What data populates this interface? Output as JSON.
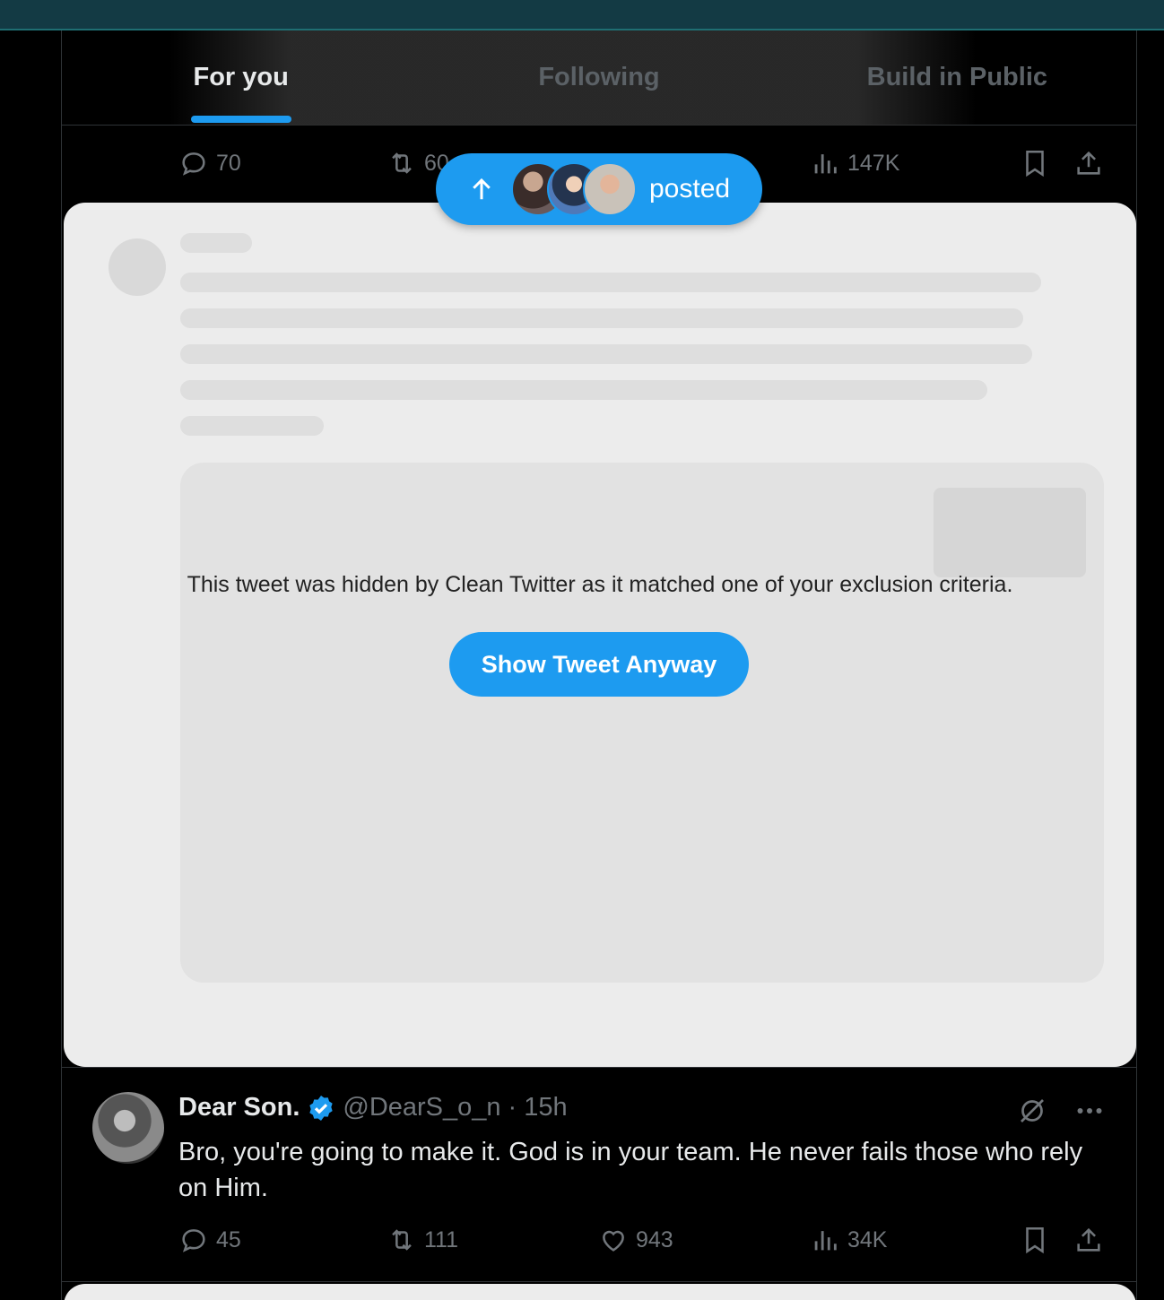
{
  "tabs": [
    {
      "label": "For you",
      "active": true
    },
    {
      "label": "Following",
      "active": false
    },
    {
      "label": "Build in Public",
      "active": false
    }
  ],
  "prev_tweet_actions": {
    "replies": "70",
    "retweets": "60",
    "views": "147K"
  },
  "posted_pill": {
    "label": "posted"
  },
  "hidden_tweet": {
    "message": "This tweet was hidden by Clean Twitter as it matched one of your exclusion criteria.",
    "button_label": "Show Tweet Anyway"
  },
  "tweet": {
    "name": "Dear Son.",
    "handle": "@DearS_o_n",
    "separator": "·",
    "time": "15h",
    "body": "Bro, you're going to make it. God is in your team. He never fails those who rely on Him.",
    "replies": "45",
    "retweets": "111",
    "likes": "943",
    "views": "34K"
  },
  "colors": {
    "accent": "#1d9bf0",
    "muted": "#71767b",
    "text": "#e7e9ea",
    "card_bg": "#ececec"
  }
}
